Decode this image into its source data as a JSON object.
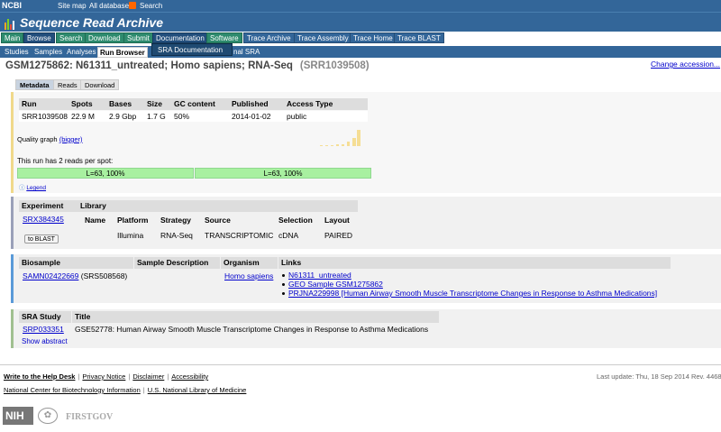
{
  "topbar": {
    "ncbi": "NCBI",
    "site_map": "Site map",
    "all_databases": "All databases",
    "search": "Search"
  },
  "app_title": "Sequence Read Archive",
  "main_nav": [
    "Main",
    "Browse",
    "Search",
    "Download",
    "Submit",
    "Documentation",
    "Software",
    "Trace Archive",
    "Trace Assembly",
    "Trace Home",
    "Trace BLAST"
  ],
  "sub_nav": [
    "Studies",
    "Samples",
    "Analyses",
    "Run Browser",
    "nal SRA"
  ],
  "sra_doc_dropdown": "SRA Documentation",
  "heading": {
    "title": "GSM1275862: N61311_untreated; Homo sapiens; RNA-Seq",
    "accession": "(SRR1039508)"
  },
  "change_accession": "Change accession...",
  "run_tabs": [
    "Metadata",
    "Reads",
    "Download"
  ],
  "run_table": {
    "headers": [
      "Run",
      "Spots",
      "Bases",
      "Size",
      "GC content",
      "Published",
      "Access Type"
    ],
    "row": [
      "SRR1039508",
      "22.9 M",
      "2.9 Gbp",
      "1.7 G",
      "50%",
      "2014-01-02",
      "public"
    ]
  },
  "quality": {
    "label": "Quality graph",
    "bigger": "(bigger)"
  },
  "reads_per_spot": "This run has 2 reads per spot:",
  "read_bars": [
    "L=63, 100%",
    "L=63, 100%"
  ],
  "legend": "Legend",
  "experiment": {
    "header": "Experiment",
    "accession": "SRX384345",
    "blast_button": "to BLAST",
    "library_header": "Library",
    "lib_headers": [
      "Name",
      "Platform",
      "Strategy",
      "Source",
      "Selection",
      "Layout"
    ],
    "lib_row": [
      "",
      "Illumina",
      "RNA-Seq",
      "TRANSCRIPTOMIC",
      "cDNA",
      "PAIRED"
    ]
  },
  "biosample": {
    "headers": [
      "Biosample",
      "Sample Description",
      "Organism",
      "Links"
    ],
    "accession": "SAMN02422669",
    "alt": "(SRS508568)",
    "organism": "Homo sapiens",
    "links": [
      "N61311_untreated",
      "GEO Sample GSM1275862",
      "PRJNA229998 [Human Airway Smooth Muscle Transcriptome Changes in Response to Asthma Medications]"
    ]
  },
  "study": {
    "headers": [
      "SRA Study",
      "Title"
    ],
    "accession": "SRP033351",
    "title": "GSE52778: Human Airway Smooth Muscle Transcriptome Changes in Response to Asthma Medications",
    "show_abstract": "Show abstract"
  },
  "footer": {
    "row1": [
      "Write to the Help Desk",
      "Privacy Notice",
      "Disclaimer",
      "Accessibility"
    ],
    "row2": [
      "National Center for Biotechnology Information",
      "U.S. National Library of Medicine"
    ],
    "last_update": "Last update: Thu, 18 Sep 2014 Rev. 446801",
    "nih": "NIH",
    "firstgov": "FIRSTGOV"
  },
  "colors": {
    "nav_blue": "#336699",
    "nav_green": "#2e8b6e",
    "read_bar": "#a8f0a0",
    "quality_bar": "#f5de95"
  }
}
